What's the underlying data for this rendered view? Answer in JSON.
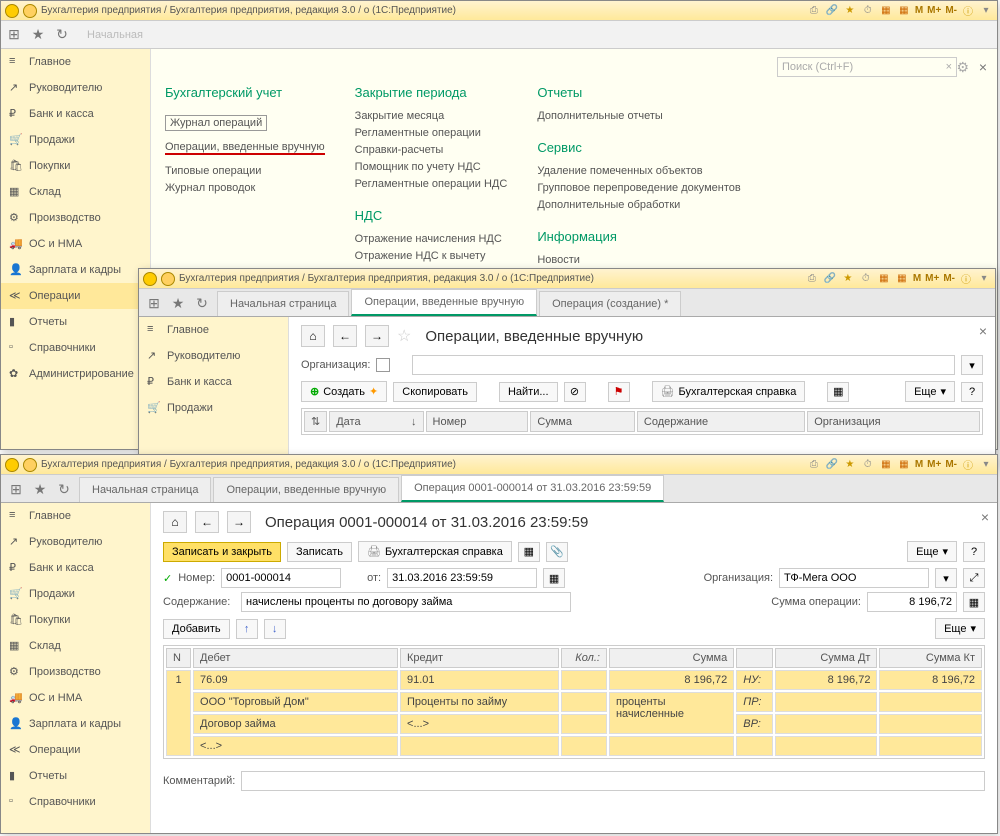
{
  "app_title": "Бухгалтерия предприятия / Бухгалтерия предприятия, редакция 3.0 / o   (1C:Предприятие)",
  "tb_m": [
    "M",
    "M+",
    "M-"
  ],
  "search_placeholder": "Поиск (Ctrl+F)",
  "start_page": "Начальная",
  "sidebar": [
    {
      "ic": "≡",
      "label": "Главное"
    },
    {
      "ic": "↗",
      "label": "Руководителю"
    },
    {
      "ic": "₽",
      "label": "Банк и касса"
    },
    {
      "ic": "🛒",
      "label": "Продажи"
    },
    {
      "ic": "🛍",
      "label": "Покупки"
    },
    {
      "ic": "▦",
      "label": "Склад"
    },
    {
      "ic": "⚙",
      "label": "Производство"
    },
    {
      "ic": "🚚",
      "label": "ОС и НМА"
    },
    {
      "ic": "👤",
      "label": "Зарплата и кадры"
    },
    {
      "ic": "≪",
      "label": "Операции"
    },
    {
      "ic": "▮",
      "label": "Отчеты"
    },
    {
      "ic": "▫",
      "label": "Справочники"
    },
    {
      "ic": "✿",
      "label": "Администрирование"
    }
  ],
  "menu": {
    "col1": {
      "h": "Бухгалтерский учет",
      "items": [
        "Журнал операций",
        "Операции, введенные вручную",
        "Типовые операции",
        "Журнал проводок"
      ]
    },
    "col2a": {
      "h": "Закрытие периода",
      "items": [
        "Закрытие месяца",
        "Регламентные операции",
        "Справки-расчеты",
        "Помощник по учету НДС",
        "Регламентные операции НДС"
      ]
    },
    "col2b": {
      "h": "НДС",
      "items": [
        "Отражение начисления НДС",
        "Отражение НДС к вычету"
      ]
    },
    "col3a": {
      "h": "Отчеты",
      "items": [
        "Дополнительные отчеты"
      ]
    },
    "col3b": {
      "h": "Сервис",
      "items": [
        "Удаление помеченных объектов",
        "Групповое перепроведение документов",
        "Дополнительные обработки"
      ]
    },
    "col3c": {
      "h": "Информация",
      "items": [
        "Новости"
      ]
    }
  },
  "win2": {
    "tabs": [
      "Начальная страница",
      "Операции, введенные вручную",
      "Операция (создание) *"
    ],
    "title": "Операции, введенные вручную",
    "org_label": "Организация:",
    "btns": {
      "create": "Создать",
      "copy": "Скопировать",
      "find": "Найти...",
      "ref": "Бухгалтерская справка",
      "more": "Еще"
    },
    "cols": [
      "Дата",
      "Номер",
      "Сумма",
      "Содержание",
      "Организация"
    ]
  },
  "win3": {
    "tabs": [
      "Начальная страница",
      "Операции, введенные вручную",
      "Операция 0001-000014 от 31.03.2016 23:59:59"
    ],
    "title": "Операция 0001-000014 от 31.03.2016 23:59:59",
    "save_close": "Записать и закрыть",
    "save": "Записать",
    "acct_ref": "Бухгалтерская справка",
    "more": "Еще",
    "number_label": "Номер:",
    "number": "0001-000014",
    "from_label": "от:",
    "date": "31.03.2016 23:59:59",
    "org_label": "Организация:",
    "org": "ТФ-Мега ООО",
    "content_label": "Содержание:",
    "content": "начислены проценты по договору займа",
    "sum_label": "Сумма операции:",
    "sum": "8 196,72",
    "add": "Добавить",
    "cols": {
      "n": "N",
      "debet": "Дебет",
      "kredit": "Кредит",
      "kol": "Кол.:",
      "summa": "Сумма",
      "summa_dt": "Сумма Дт",
      "summa_kt": "Сумма Кт"
    },
    "row": {
      "n": "1",
      "d1": "76.09",
      "d2": "ООО \"Торговый Дом\"",
      "d3": "Договор займа",
      "d4": "<...>",
      "k1": "91.01",
      "k2": "Проценты по займу",
      "k3": "<...>",
      "s": "8 196,72",
      "s_note": "проценты начисленные",
      "nu": "НУ:",
      "pr": "ПР:",
      "vr": "ВР:",
      "dt": "8 196,72",
      "kt": "8 196,72"
    },
    "comment_label": "Комментарий:"
  }
}
